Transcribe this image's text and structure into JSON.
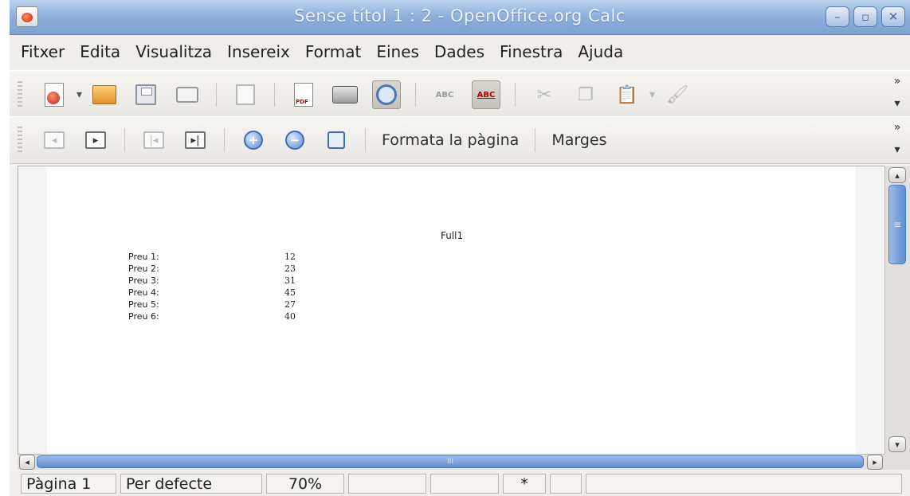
{
  "window": {
    "title": "Sense títol 1 : 2 - OpenOffice.org Calc",
    "buttons": [
      "minimize-icon",
      "maximize-icon",
      "close-icon"
    ]
  },
  "menu": [
    {
      "label": "Fitxer"
    },
    {
      "label": "Edita"
    },
    {
      "label": "Visualitza"
    },
    {
      "label": "Insereix"
    },
    {
      "label": "Format"
    },
    {
      "label": "Eines"
    },
    {
      "label": "Dades"
    },
    {
      "label": "Finestra"
    },
    {
      "label": "Ajuda"
    }
  ],
  "toolbar1": {
    "icons": [
      "new-document-icon",
      "open-folder-icon",
      "save-icon",
      "email-icon",
      "edit-file-icon",
      "export-pdf-icon",
      "print-icon",
      "page-preview-icon",
      "spellcheck-icon",
      "autospellcheck-icon",
      "cut-icon",
      "copy-icon",
      "paste-icon",
      "format-paintbrush-icon"
    ],
    "spell_label": "ABC"
  },
  "toolbar2": {
    "icons": [
      "previous-page-icon",
      "next-page-icon",
      "first-page-icon",
      "last-page-icon",
      "zoom-in-icon",
      "zoom-out-icon",
      "full-screen-icon"
    ],
    "format_page_label": "Formata la pàgina",
    "margins_label": "Marges"
  },
  "preview": {
    "header": "Full1",
    "rows": [
      {
        "label": "Preu 1:",
        "value": "12"
      },
      {
        "label": "Preu 2:",
        "value": "23"
      },
      {
        "label": "Preu 3:",
        "value": "31"
      },
      {
        "label": "Preu 4:",
        "value": "45"
      },
      {
        "label": "Preu 5:",
        "value": "27"
      },
      {
        "label": "Preu 6:",
        "value": "40"
      }
    ]
  },
  "status": {
    "page": "Pàgina 1",
    "style": "Per defecte",
    "zoom": "70%",
    "modified": "*"
  },
  "colors": {
    "titlebar": "#8fb0dc",
    "scroll_thumb": "#5e8fd2"
  }
}
